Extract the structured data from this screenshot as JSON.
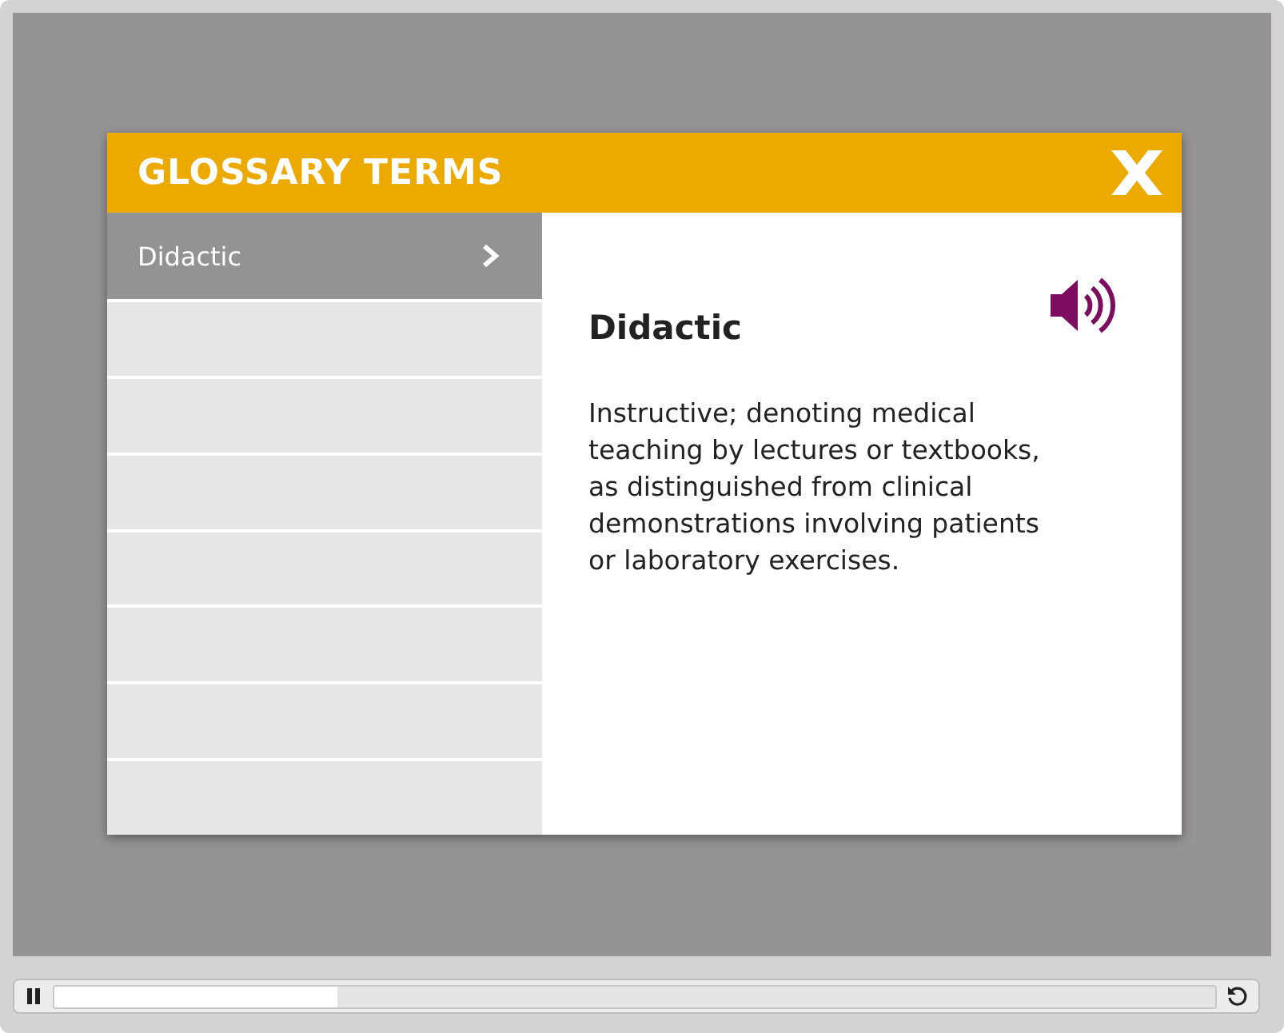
{
  "dialog": {
    "title": "GLOSSARY TERMS"
  },
  "terms": [
    {
      "label": "Didactic",
      "selected": true
    }
  ],
  "definition": {
    "term": "Didactic",
    "text": "Instructive; denoting medical teaching by lectures or textbooks, as distinguished from clinical demonstrations involving patients or laboratory exercises."
  },
  "player": {
    "playing": true,
    "level": 0.244
  }
}
